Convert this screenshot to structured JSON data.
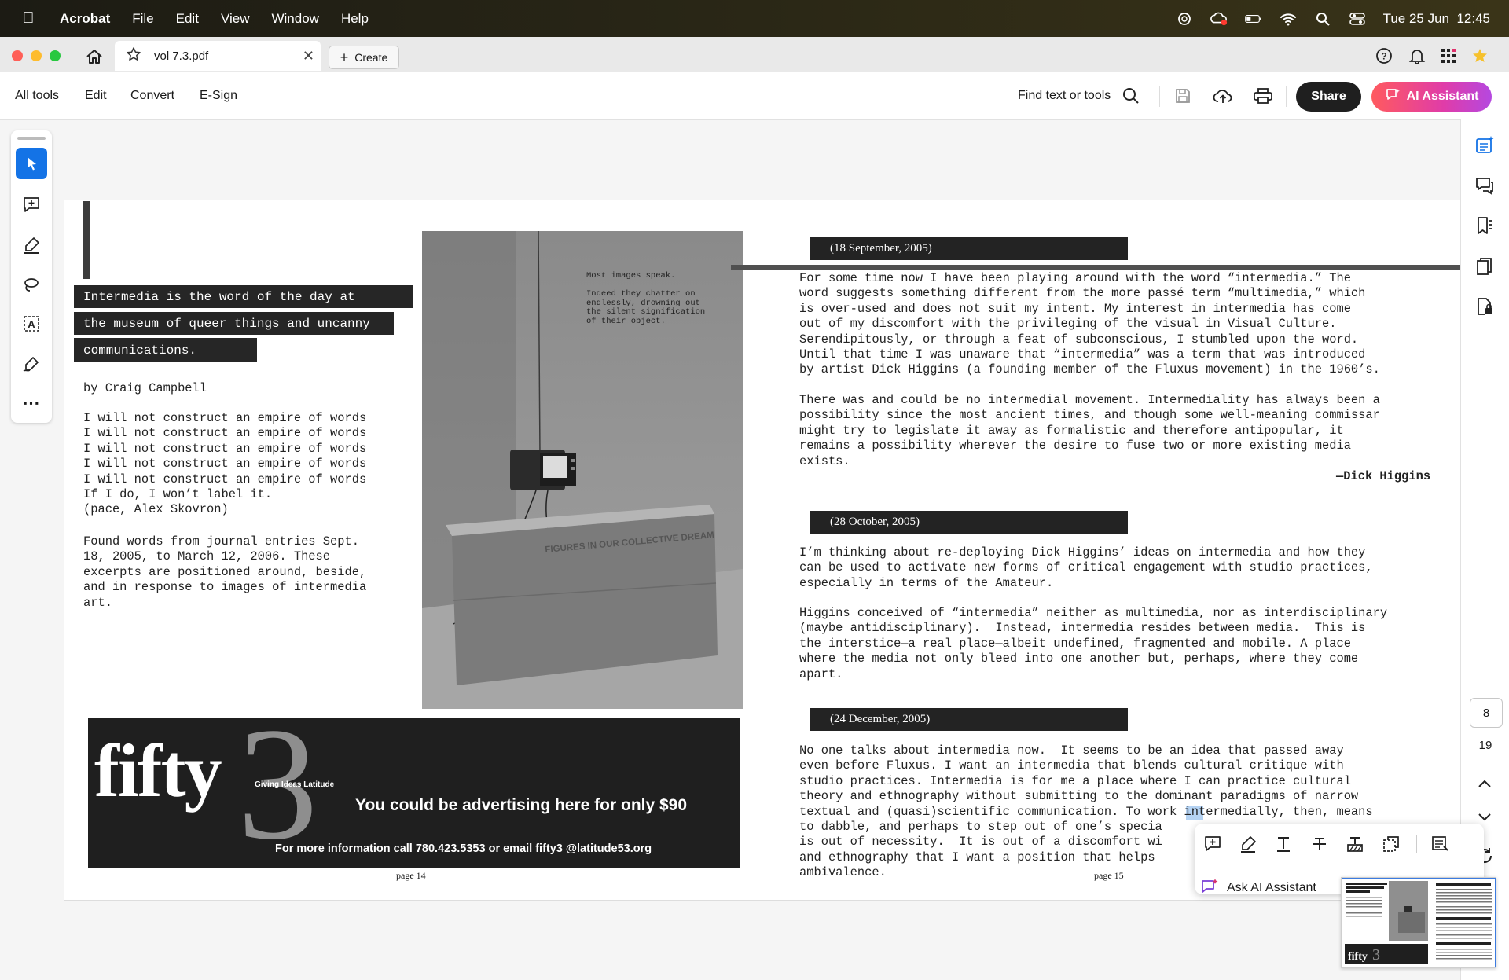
{
  "menubar": {
    "app_name": "Acrobat",
    "items": [
      "File",
      "Edit",
      "View",
      "Window",
      "Help"
    ],
    "datetime": "Tue 25 Jun  12:45"
  },
  "tab": {
    "title": "vol 7.3.pdf",
    "create_label": "Create"
  },
  "toolbar": {
    "menu": [
      "All tools",
      "Edit",
      "Convert",
      "E-Sign"
    ],
    "find_label": "Find text or tools",
    "share_label": "Share",
    "ai_label": "AI Assistant"
  },
  "left_page": {
    "headline_lines": [
      "Intermedia is the word of the day at",
      "the museum of queer things and uncanny",
      "communications."
    ],
    "byline": "by Craig Campbell",
    "poem": "I will not construct an empire of words\nI will not construct an empire of words\nI will not construct an empire of words\nI will not construct an empire of words\nI will not construct an empire of words\nIf I do, I won’t label it.\n(pace, Alex Skovron)",
    "found_words": "Found words from journal entries Sept.\n18, 2005, to March 12, 2006. These\nexcerpts are positioned around, beside,\nand in response to images of intermedia\nart.",
    "photo_caption": "Most images speak.\n\nIndeed they chatter on\nendlessly, drowning out\nthe silent signification\nof their object.",
    "box_text": "FIGURES IN OUR COLLECTIVE DREAM",
    "ad": {
      "logo": "fifty",
      "logo_num": "3",
      "tagline": "Giving Ideas Latitude",
      "headline": "You could be advertising here for only $90",
      "info": "For more information call 780.423.5353 or email fifty3 @latitude53.org"
    },
    "page_label": "page 14"
  },
  "right_page": {
    "entries": [
      {
        "date": "(18 September, 2005)",
        "paragraphs": [
          "For some time now I have been playing around with the word “intermedia.” The\nword suggests something different from the more passé term “multimedia,” which\nis over-used and does not suit my intent. My interest in intermedia has come\nout of my discomfort with the privileging of the visual in Visual Culture.\nSerendipitously, or through a feat of subconscious, I stumbled upon the word.\nUntil that time I was unaware that “intermedia” was a term that was introduced\nby artist Dick Higgins (a founding member of the Fluxus movement) in the 1960’s.",
          "There was and could be no intermedial movement. Intermediality has always been a\npossibility since the most ancient times, and though some well-meaning commissar\nmight try to legislate it away as formalistic and therefore antipopular, it\nremains a possibility wherever the desire to fuse two or more existing media\nexists."
        ],
        "attribution": "—Dick Higgins"
      },
      {
        "date": "(28 October, 2005)",
        "paragraphs": [
          "I’m thinking about re-deploying Dick Higgins’ ideas on intermedia and how they\ncan be used to activate new forms of critical engagement with studio practices,\nespecially in terms of the Amateur.",
          "Higgins conceived of “intermedia” neither as multimedia, nor as interdisciplinary\n(maybe antidisciplinary).  Instead, intermedia resides between media.  This is\nthe interstice—a real place—albeit undefined, fragmented and mobile. A place\nwhere the media not only bleed into one another but, perhaps, where they come\napart."
        ]
      },
      {
        "date": "(24 December, 2005)",
        "paragraphs": [
          "No one talks about intermedia now.  It seems to be an idea that passed away\neven before Fluxus. I want an intermedia that blends cultural critique with\nstudio practices. Intermedia is for me a place where I can practice cultural\ntheory and ethnography without submitting to the dominant paradigms of narrow\ntextual and (quasi)scientific communication. To work intermedially, then, means\nto dabble, and perhaps to step out of one’s specia\nis out of necessity.  It is out of a discomfort wi\nand ethnography that I want a position that helps\nambivalence."
        ]
      }
    ],
    "page_label": "page 15"
  },
  "context_toolbar": {
    "ask_ai_label": "Ask AI Assistant"
  },
  "navigation": {
    "current_page": "8",
    "total_pages": "19"
  }
}
